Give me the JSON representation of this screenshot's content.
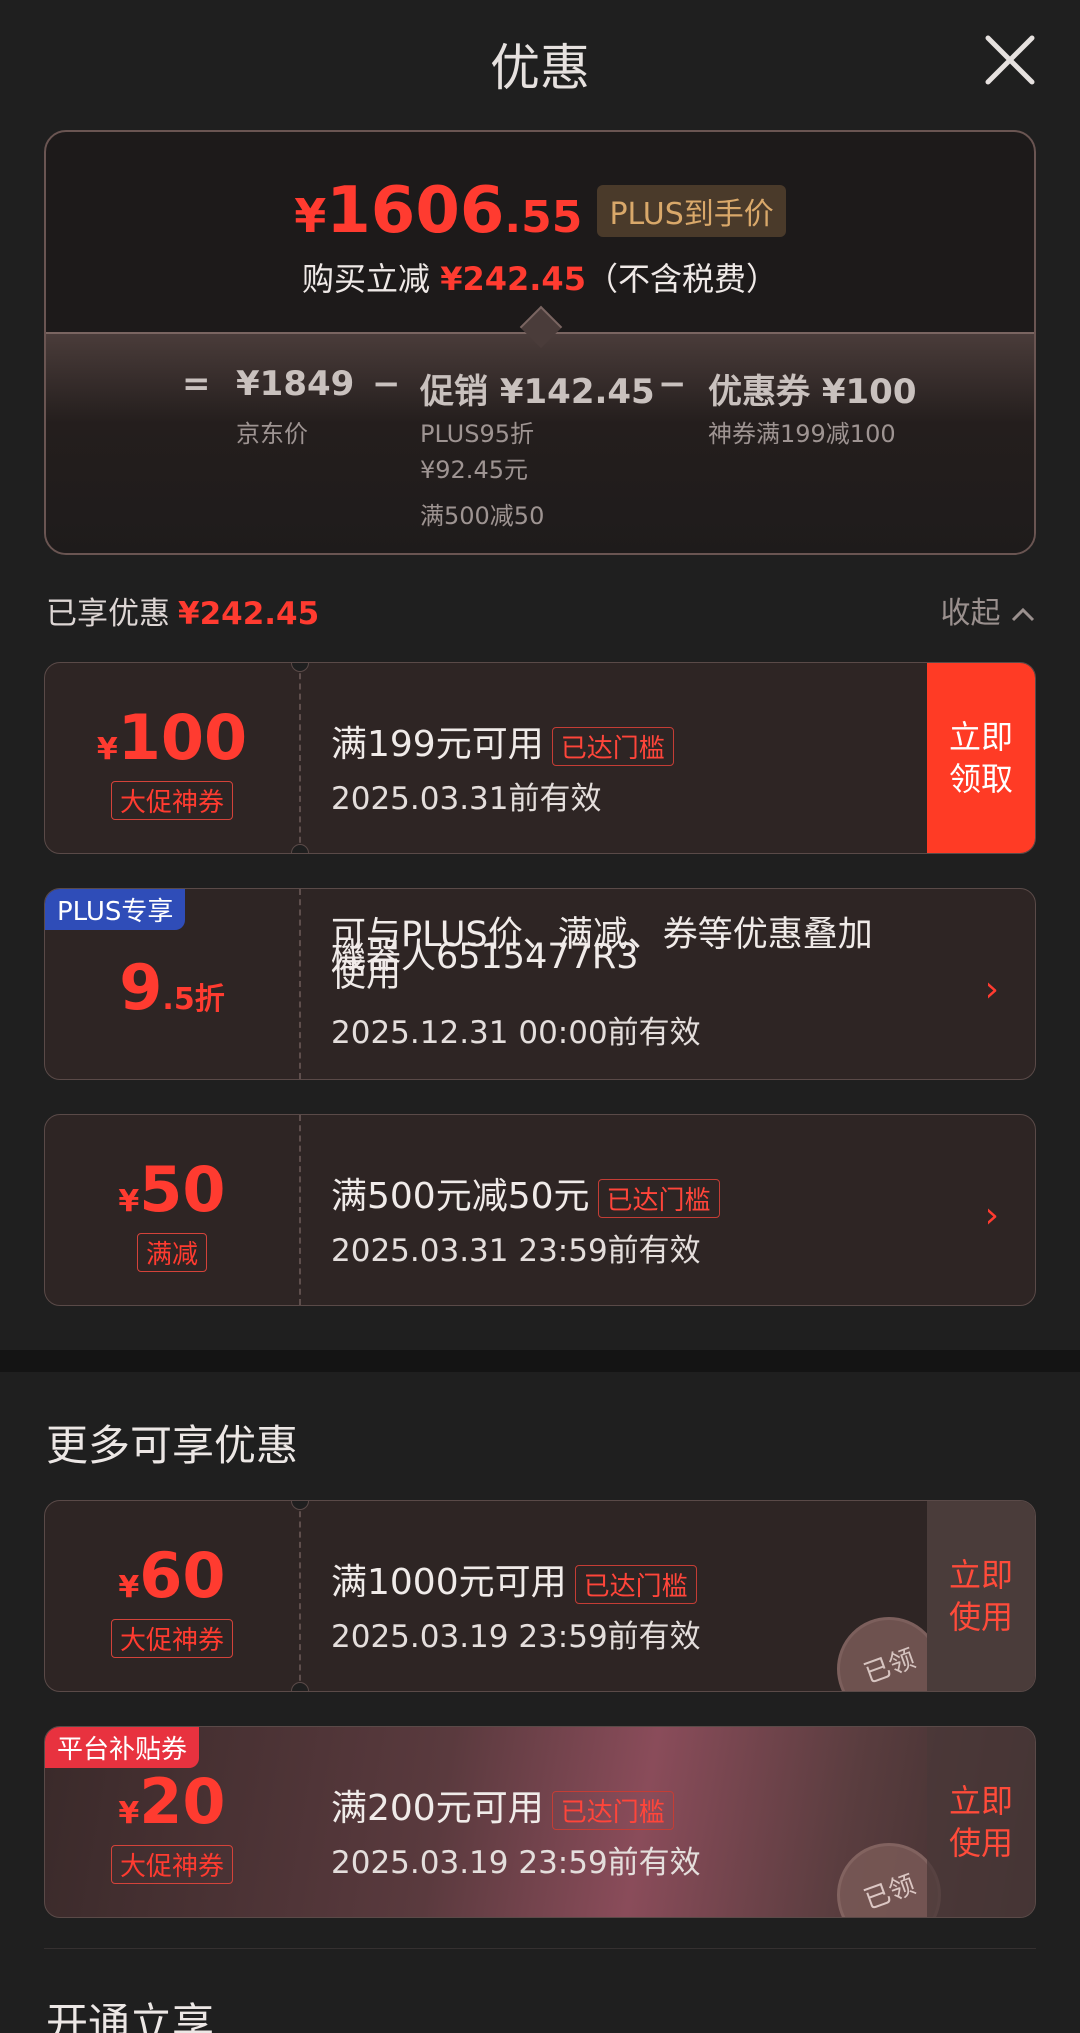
{
  "header": {
    "title": "优惠"
  },
  "summary": {
    "price_currency": "¥",
    "price_int": "1606",
    "price_cents": ".55",
    "price_badge": "PLUS到手价",
    "reduce_prefix": "购买立减",
    "reduce_amount": "¥242.45",
    "reduce_suffix": "（不含税费）",
    "formula": {
      "eq": "=",
      "minus": "−",
      "jd_price": "¥1849",
      "jd_label": "京东价",
      "promo_label": "促销",
      "promo_amount": "¥142.45",
      "promo_sub1": "PLUS95折",
      "promo_sub2": "¥92.45元",
      "promo_sub3": "满500减50",
      "coupon_label": "优惠券",
      "coupon_amount": "¥100",
      "coupon_sub": "神券满199减100"
    }
  },
  "enjoyed": {
    "label": "已享优惠",
    "amount": "¥242.45",
    "collapse": "收起"
  },
  "coupons": [
    {
      "yen": "¥",
      "amount": "100",
      "tag": "大促神券",
      "cond": "满199元可用",
      "badge": "已达门槛",
      "valid": "2025.03.31前有效",
      "action": "立即领取"
    },
    {
      "corner": "PLUS专享",
      "amount_main": "9",
      "amount_small": ".5折",
      "cond_line1": "可与PLUS价、满减、券等优惠叠加",
      "cond_overlay": "機器人6515477R3",
      "cond_line2": "使用",
      "valid": "2025.12.31 00:00前有效",
      "chevron": "›"
    },
    {
      "yen": "¥",
      "amount": "50",
      "tag": "满减",
      "cond": "满500元减50元",
      "badge": "已达门槛",
      "valid": "2025.03.31 23:59前有效",
      "chevron": "›"
    }
  ],
  "more": {
    "title": "更多可享优惠",
    "coupons": [
      {
        "yen": "¥",
        "amount": "60",
        "tag": "大促神券",
        "cond": "满1000元可用",
        "badge": "已达门槛",
        "valid": "2025.03.19 23:59前有效",
        "action": "立即使用",
        "stamp": "已领"
      },
      {
        "corner": "平台补贴券",
        "yen": "¥",
        "amount": "20",
        "tag": "大促神券",
        "cond": "满200元可用",
        "badge": "已达门槛",
        "valid": "2025.03.19 23:59前有效",
        "action": "立即使用",
        "stamp": "已领"
      }
    ]
  },
  "open": {
    "title": "开通立享"
  },
  "colors": {
    "accent": "#ff3b30",
    "plus_blue": "#2f4db8",
    "subsidy_red": "#e8323f"
  }
}
